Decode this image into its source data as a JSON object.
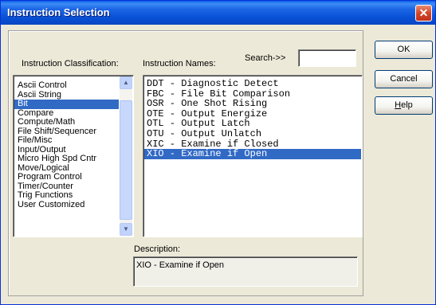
{
  "window": {
    "title": "Instruction Selection",
    "close_glyph": "✕"
  },
  "classification": {
    "label": "Instruction Classification:",
    "items": [
      "Ascii Control",
      "Ascii String",
      "Bit",
      "Compare",
      "Compute/Math",
      "File Shift/Sequencer",
      "File/Misc",
      "Input/Output",
      "Micro High Spd Cntr",
      "Move/Logical",
      "Program Control",
      "Timer/Counter",
      "Trig Functions",
      "User Customized"
    ],
    "selected": "Bit"
  },
  "names": {
    "label": "Instruction Names:",
    "items": [
      "DDT - Diagnostic Detect",
      "FBC - File Bit Comparison",
      "OSR - One Shot Rising",
      "OTE - Output Energize",
      "OTL - Output Latch",
      "OTU - Output Unlatch",
      "XIC - Examine if Closed",
      "XIO - Examine if Open"
    ],
    "selected": "XIO - Examine if Open"
  },
  "search": {
    "label": "Search->>",
    "value": ""
  },
  "description": {
    "label": "Description:",
    "text": "XIO - Examine if Open"
  },
  "buttons": {
    "ok": "OK",
    "cancel": "Cancel",
    "help": "Help"
  },
  "colors": {
    "title_bar": "#0a5fe8",
    "selection": "#316ac5",
    "dialog_bg": "#ece9d8"
  }
}
